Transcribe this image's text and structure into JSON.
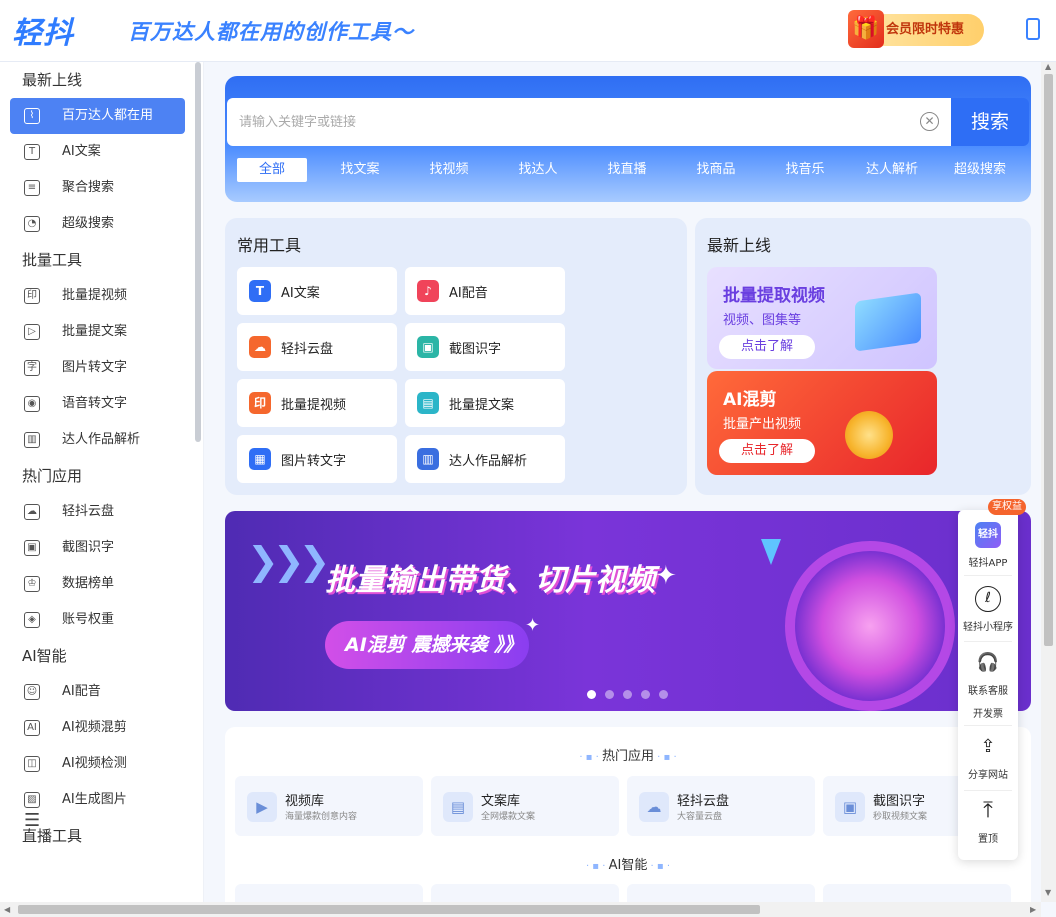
{
  "header": {
    "logo": "轻抖",
    "slogan": "百万达人都在用的创作工具～",
    "vip_label": "会员限时特惠"
  },
  "sidebar": {
    "groups": [
      {
        "title": "最新上线",
        "items": [
          {
            "label": "百万达人都在用",
            "icon": "chart-icon",
            "active": true
          },
          {
            "label": "AI文案",
            "icon": "text-icon"
          },
          {
            "label": "聚合搜索",
            "icon": "list-search-icon"
          },
          {
            "label": "超级搜索",
            "icon": "magnify-icon"
          }
        ]
      },
      {
        "title": "批量工具",
        "items": [
          {
            "label": "批量提视频",
            "icon": "stamp-icon"
          },
          {
            "label": "批量提文案",
            "icon": "play-doc-icon"
          },
          {
            "label": "图片转文字",
            "icon": "image-text-icon"
          },
          {
            "label": "语音转文字",
            "icon": "voice-icon"
          },
          {
            "label": "达人作品解析",
            "icon": "bar-chart-icon"
          }
        ]
      },
      {
        "title": "热门应用",
        "items": [
          {
            "label": "轻抖云盘",
            "icon": "cloud-icon"
          },
          {
            "label": "截图识字",
            "icon": "screenshot-icon"
          },
          {
            "label": "数据榜单",
            "icon": "crown-icon"
          },
          {
            "label": "账号权重",
            "icon": "shield-icon"
          }
        ]
      },
      {
        "title": "AI智能",
        "items": [
          {
            "label": "AI配音",
            "icon": "person-voice-icon"
          },
          {
            "label": "AI视频混剪",
            "icon": "ai-cut-icon"
          },
          {
            "label": "AI视频检测",
            "icon": "detect-icon"
          },
          {
            "label": "AI生成图片",
            "icon": "ai-image-icon"
          }
        ]
      },
      {
        "title": "直播工具",
        "items": []
      }
    ]
  },
  "search": {
    "placeholder": "请输入关键字或链接",
    "button": "搜索",
    "categories": [
      "全部",
      "找文案",
      "找视频",
      "找达人",
      "找直播",
      "找商品",
      "找音乐",
      "达人解析",
      "超级搜索"
    ]
  },
  "common_tools": {
    "title": "常用工具",
    "items": [
      {
        "label": "AI文案",
        "color": "#2f6ef5",
        "glyph": "T"
      },
      {
        "label": "AI配音",
        "color": "#f0445a",
        "glyph": "♪"
      },
      {
        "label": "轻抖云盘",
        "color": "#f5672d",
        "glyph": "☁"
      },
      {
        "label": "截图识字",
        "color": "#2bb5a6",
        "glyph": "▣"
      },
      {
        "label": "批量提视频",
        "color": "#f5672d",
        "glyph": "印"
      },
      {
        "label": "批量提文案",
        "color": "#2bb5c8",
        "glyph": "▤"
      },
      {
        "label": "图片转文字",
        "color": "#2f6ef5",
        "glyph": "▦"
      },
      {
        "label": "达人作品解析",
        "color": "#3a6ee0",
        "glyph": "▥"
      }
    ]
  },
  "latest": {
    "title": "最新上线",
    "promo1": {
      "title": "批量提取视频",
      "sub": "视频、图集等",
      "button": "点击了解"
    },
    "promo2": {
      "title": "AI混剪",
      "sub": "批量产出视频",
      "button": "点击了解"
    }
  },
  "banner": {
    "title": "批量输出带货、切片视频",
    "pill": "AI混剪 震撼来袭 》》"
  },
  "apps": {
    "hot_title": "热门应用",
    "ai_title": "AI智能",
    "items": [
      {
        "name": "视频库",
        "desc": "海量爆款创意内容"
      },
      {
        "name": "文案库",
        "desc": "全网爆款文案"
      },
      {
        "name": "轻抖云盘",
        "desc": "大容量云盘"
      },
      {
        "name": "截图识字",
        "desc": "秒取视频文案"
      }
    ]
  },
  "float_bar": {
    "badge": "享权益",
    "app_logo": "轻抖",
    "items": [
      {
        "label": "轻抖APP"
      },
      {
        "label": "轻抖小程序"
      },
      {
        "label": "联系客服"
      },
      {
        "label": "开发票"
      },
      {
        "label": "分享网站"
      },
      {
        "label": "置顶"
      }
    ]
  }
}
